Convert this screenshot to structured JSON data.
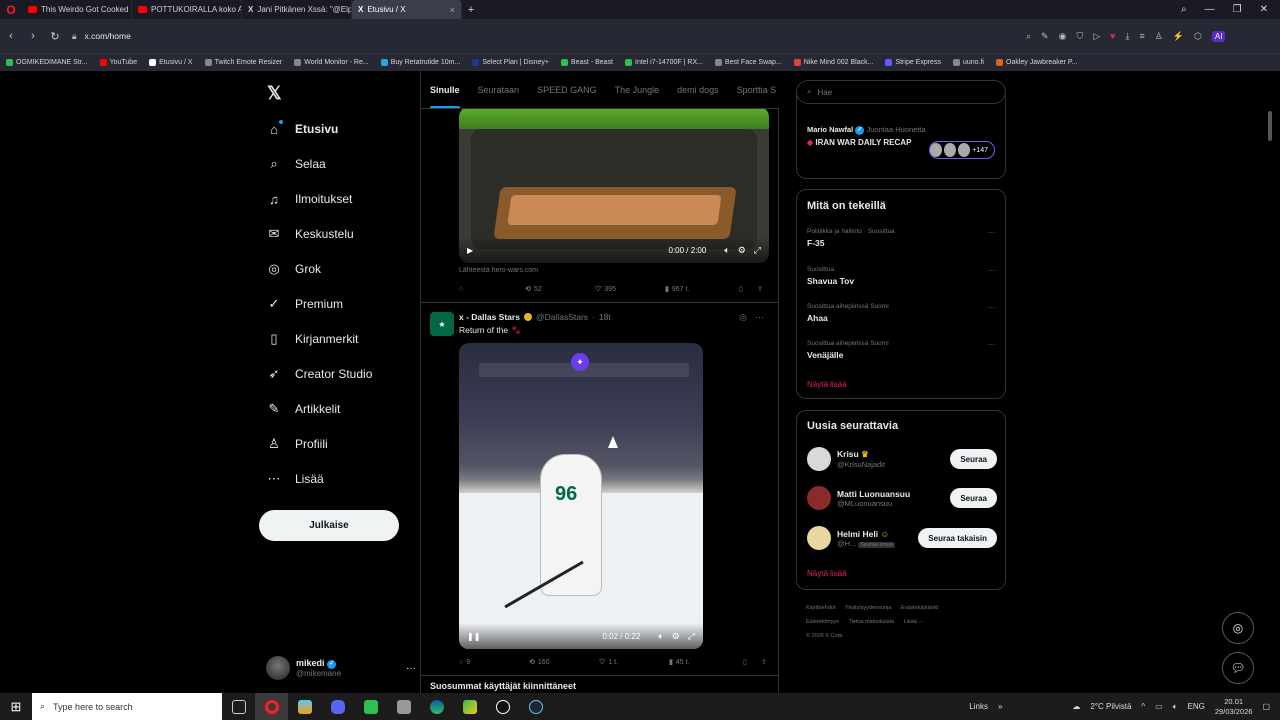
{
  "browser": {
    "tabs": [
      {
        "title": "This Weirdo Got Cooked",
        "color": "#ff0000"
      },
      {
        "title": "POTTUKOIRALLA koko Ar",
        "color": "#ff0000"
      },
      {
        "title": "Jani Pitkänen Xssä: \"@Elp",
        "color": "#ffffff"
      },
      {
        "title": "Etusivu / X",
        "color": "#ffffff"
      }
    ],
    "url": "x.com/home",
    "ai_label": "AI",
    "bookmarks": [
      {
        "label": "OGMIKEDIMANE Str...",
        "color": "#30c050"
      },
      {
        "label": "YouTube",
        "color": "#ff0000"
      },
      {
        "label": "Etusivu / X",
        "color": "#ffffff"
      },
      {
        "label": "Twitch Emote Resizer",
        "color": "#888888"
      },
      {
        "label": "World Monitor - Re...",
        "color": "#888888"
      },
      {
        "label": "Buy Retatrutide 10m...",
        "color": "#2aa7e0"
      },
      {
        "label": "Select Plan | Disney+",
        "color": "#1a3c8f"
      },
      {
        "label": "Beast - Beast",
        "color": "#30c050"
      },
      {
        "label": "Intel i7-14700F | RX...",
        "color": "#30c050"
      },
      {
        "label": "Best Face Swap...",
        "color": "#888888"
      },
      {
        "label": "Nike Mind 002 Black...",
        "color": "#e04040"
      },
      {
        "label": "Stripe Express",
        "color": "#635bff"
      },
      {
        "label": "uuno.fi",
        "color": "#888888"
      },
      {
        "label": "Oakley Jawbreaker P...",
        "color": "#e06020"
      }
    ]
  },
  "nav": {
    "items": [
      {
        "label": "Etusivu",
        "icon": "home-icon",
        "glyph": "⌂"
      },
      {
        "label": "Selaa",
        "icon": "search-icon",
        "glyph": "⌕"
      },
      {
        "label": "Ilmoitukset",
        "icon": "bell-icon",
        "glyph": "🔔"
      },
      {
        "label": "Keskustelu",
        "icon": "mail-icon",
        "glyph": "✉"
      },
      {
        "label": "Grok",
        "icon": "grok-icon",
        "glyph": "◎"
      },
      {
        "label": "Premium",
        "icon": "premium-icon",
        "glyph": "✓"
      },
      {
        "label": "Kirjanmerkit",
        "icon": "bookmark-icon",
        "glyph": "▯"
      },
      {
        "label": "Creator Studio",
        "icon": "rocket-icon",
        "glyph": "➶"
      },
      {
        "label": "Artikkelit",
        "icon": "article-icon",
        "glyph": "✎"
      },
      {
        "label": "Profiili",
        "icon": "person-icon",
        "glyph": "♙"
      },
      {
        "label": "Lisää",
        "icon": "more-icon",
        "glyph": "⋯"
      }
    ],
    "post_label": "Julkaise",
    "profile": {
      "name": "mikedi",
      "handle": "@mikemane"
    }
  },
  "feed": {
    "tabs": [
      "Sinulle",
      "Seurataan",
      "SPEED GANG",
      "The Jungle",
      "demi dogs",
      "Sporttia S"
    ],
    "video1": {
      "time": "0:00 / 2:00"
    },
    "source": "Lähteestä hero-wars.com",
    "post1_actions": {
      "retweets": "52",
      "likes": "395",
      "views": "967 t."
    },
    "post2": {
      "name": "x - Dallas Stars",
      "handle": "@DallasStars",
      "age": "18t",
      "text": "Return of the",
      "video_time": "0:02 / 0:22",
      "jersey_number": "96",
      "replies": "9",
      "retweets": "160",
      "likes": "1 t.",
      "views": "45 t."
    },
    "next_post_peek": "Suosummat käyttäjät kiinnittäneet"
  },
  "sidebar": {
    "search_placeholder": "Hae",
    "news": {
      "who": "Mario Nawfal",
      "sub": "Juontaa Huonetta",
      "title": "IRAN WAR DAILY RECAP",
      "count": "+147"
    },
    "trending_title": "Mitä on tekeillä",
    "trends": [
      {
        "category": "Politiikka ja hallinto · Suosittua",
        "name": "F-35"
      },
      {
        "category": "Suosittua",
        "name": "Shavua Tov"
      },
      {
        "category": "Suosittua aihepiirissä Suomi",
        "name": "Ahaa"
      },
      {
        "category": "Suosittua aihepiirissä Suomi",
        "name": "Venäjälle"
      }
    ],
    "show_more": "Näytä lisää",
    "follow_title": "Uusia seurattavia",
    "follows": [
      {
        "name": "Krisu",
        "handle": "@KrisuNajadit",
        "button": "Seuraa",
        "color": "#d9d9d9"
      },
      {
        "name": "Matti Luonuansuu",
        "handle": "@MLuonuansuu",
        "button": "Seuraa",
        "color": "#8b2a2a"
      },
      {
        "name": "Helmi Heli",
        "handle": "@H...",
        "badge": "Seuraa sinua",
        "button": "Seuraa takaisin",
        "color": "#e8d8a0"
      }
    ],
    "footer": [
      "Käyttöehdot",
      "Yksityisyydensuoja",
      "Evästekäytäntö",
      "Esteettömyys",
      "Tietoa mainoksista",
      "Lisää ···",
      "© 2026 X Corp."
    ]
  },
  "taskbar": {
    "search_placeholder": "Type here to search",
    "links": "Links",
    "weather": "2°C Pilvistä",
    "lang": "ENG",
    "time": "20.01",
    "date": "29/03/2026"
  }
}
